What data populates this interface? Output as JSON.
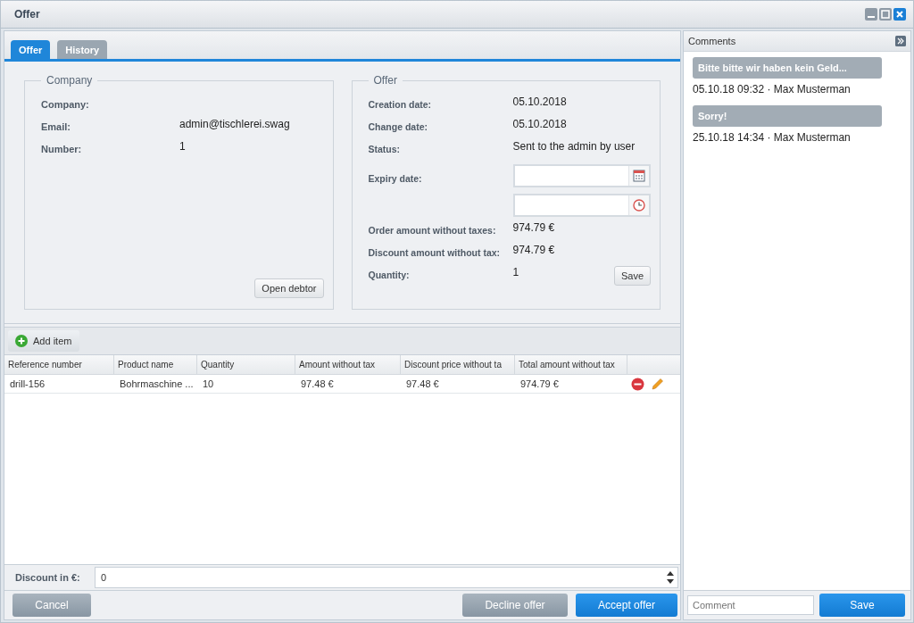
{
  "window": {
    "title": "Offer"
  },
  "tabs": [
    {
      "label": "Offer",
      "selected": true
    },
    {
      "label": "History",
      "selected": false
    }
  ],
  "company": {
    "legend": "Company",
    "fields": [
      {
        "label": "Company:"
      },
      {
        "label": "Email:",
        "value": "admin@tischlerei.swag"
      },
      {
        "label": "Number:",
        "value": "1"
      }
    ],
    "button": "Open debtor"
  },
  "offer": {
    "legend": "Offer",
    "fields": [
      {
        "kind": "text",
        "label": "Creation date:",
        "value": "05.10.2018"
      },
      {
        "kind": "text",
        "label": "Change date:",
        "value": "05.10.2018"
      },
      {
        "kind": "text",
        "label": "Status:",
        "value": "Sent to the admin by user"
      },
      {
        "kind": "date",
        "label": "Expiry date:"
      },
      {
        "kind": "time"
      },
      {
        "kind": "text",
        "label": "Order amount without taxes:",
        "value": "974.79 €"
      },
      {
        "kind": "text",
        "label": "Discount amount without tax:",
        "value": "974.79 €"
      },
      {
        "kind": "text",
        "label": "Quantity:",
        "value": "1"
      }
    ],
    "button": "Save"
  },
  "toolbar": {
    "add_button": "Add item"
  },
  "table": {
    "columns": [
      "Reference number",
      "Product name",
      "Quantity",
      "Amount without tax",
      "Discount price without ta",
      "Total amount without tax"
    ],
    "rows": [
      {
        "cells": [
          "drill-156",
          "Bohrmaschine ...",
          "10",
          "97.48 €",
          "97.48 €",
          "974.79 €"
        ]
      }
    ]
  },
  "discount": {
    "label": "Discount in €:",
    "value": "0"
  },
  "buttons": {
    "cancel": "Cancel",
    "decline": "Decline offer",
    "accept": "Accept offer"
  },
  "comments": {
    "title": "Comments",
    "items": [
      {
        "text": "Bitte bitte wir haben kein Geld...",
        "meta": "05.10.18 09:32 · Max Musterman"
      },
      {
        "text": "Sorry!",
        "meta": "25.10.18 14:34 · Max Musterman"
      }
    ],
    "placeholder": "Comment",
    "save": "Save"
  }
}
